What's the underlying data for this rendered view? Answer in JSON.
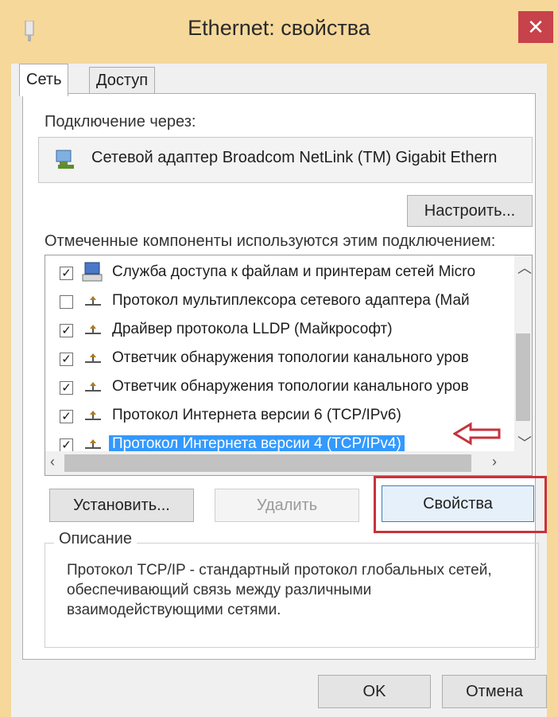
{
  "window": {
    "title": "Ethernet: свойства",
    "close_label": "✕"
  },
  "tabs": [
    {
      "label": "Сеть",
      "active": true
    },
    {
      "label": "Доступ",
      "active": false
    }
  ],
  "connection": {
    "label": "Подключение через:",
    "adapter": "Сетевой адаптер Broadcom NetLink (TM) Gigabit Ethern",
    "configure_button": "Настроить..."
  },
  "components": {
    "label": "Отмеченные компоненты используются этим подключением:",
    "items": [
      {
        "label": "Служба доступа к файлам и принтерам сетей Micro",
        "checked": true,
        "icon": "network-client-icon",
        "selected": false
      },
      {
        "label": "Протокол мультиплексора сетевого адаптера (Май",
        "checked": false,
        "icon": "protocol-icon",
        "selected": false
      },
      {
        "label": "Драйвер протокола LLDP (Майкрософт)",
        "checked": true,
        "icon": "protocol-icon",
        "selected": false
      },
      {
        "label": "Ответчик обнаружения топологии канального уров",
        "checked": true,
        "icon": "protocol-icon",
        "selected": false
      },
      {
        "label": "Ответчик обнаружения топологии канального уров",
        "checked": true,
        "icon": "protocol-icon",
        "selected": false
      },
      {
        "label": "Протокол Интернета версии 6 (TCP/IPv6)",
        "checked": true,
        "icon": "protocol-icon",
        "selected": false
      },
      {
        "label": "Протокол Интернета версии 4 (TCP/IPv4)",
        "checked": true,
        "icon": "protocol-icon",
        "selected": true
      }
    ]
  },
  "buttons": {
    "install": "Установить...",
    "remove": "Удалить",
    "properties": "Свойства",
    "ok": "OK",
    "cancel": "Отмена"
  },
  "description": {
    "title": "Описание",
    "text": "Протокол TCP/IP - стандартный протокол глобальных сетей, обеспечивающий связь между различными взаимодействующими сетями."
  },
  "colors": {
    "titlebar": "#f6d89a",
    "close": "#c7424a",
    "selection": "#3399ff",
    "annotation": "#c8323a"
  }
}
